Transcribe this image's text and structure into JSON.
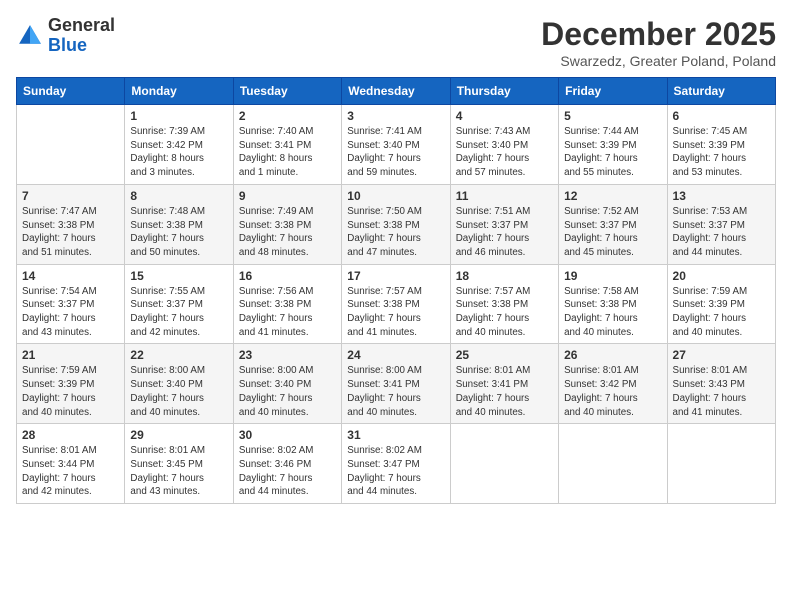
{
  "header": {
    "logo": {
      "text_general": "General",
      "text_blue": "Blue"
    },
    "title": "December 2025",
    "subtitle": "Swarzedz, Greater Poland, Poland"
  },
  "days_of_week": [
    "Sunday",
    "Monday",
    "Tuesday",
    "Wednesday",
    "Thursday",
    "Friday",
    "Saturday"
  ],
  "weeks": [
    [
      {
        "day": "",
        "info": ""
      },
      {
        "day": "1",
        "info": "Sunrise: 7:39 AM\nSunset: 3:42 PM\nDaylight: 8 hours\nand 3 minutes."
      },
      {
        "day": "2",
        "info": "Sunrise: 7:40 AM\nSunset: 3:41 PM\nDaylight: 8 hours\nand 1 minute."
      },
      {
        "day": "3",
        "info": "Sunrise: 7:41 AM\nSunset: 3:40 PM\nDaylight: 7 hours\nand 59 minutes."
      },
      {
        "day": "4",
        "info": "Sunrise: 7:43 AM\nSunset: 3:40 PM\nDaylight: 7 hours\nand 57 minutes."
      },
      {
        "day": "5",
        "info": "Sunrise: 7:44 AM\nSunset: 3:39 PM\nDaylight: 7 hours\nand 55 minutes."
      },
      {
        "day": "6",
        "info": "Sunrise: 7:45 AM\nSunset: 3:39 PM\nDaylight: 7 hours\nand 53 minutes."
      }
    ],
    [
      {
        "day": "7",
        "info": "Sunrise: 7:47 AM\nSunset: 3:38 PM\nDaylight: 7 hours\nand 51 minutes."
      },
      {
        "day": "8",
        "info": "Sunrise: 7:48 AM\nSunset: 3:38 PM\nDaylight: 7 hours\nand 50 minutes."
      },
      {
        "day": "9",
        "info": "Sunrise: 7:49 AM\nSunset: 3:38 PM\nDaylight: 7 hours\nand 48 minutes."
      },
      {
        "day": "10",
        "info": "Sunrise: 7:50 AM\nSunset: 3:38 PM\nDaylight: 7 hours\nand 47 minutes."
      },
      {
        "day": "11",
        "info": "Sunrise: 7:51 AM\nSunset: 3:37 PM\nDaylight: 7 hours\nand 46 minutes."
      },
      {
        "day": "12",
        "info": "Sunrise: 7:52 AM\nSunset: 3:37 PM\nDaylight: 7 hours\nand 45 minutes."
      },
      {
        "day": "13",
        "info": "Sunrise: 7:53 AM\nSunset: 3:37 PM\nDaylight: 7 hours\nand 44 minutes."
      }
    ],
    [
      {
        "day": "14",
        "info": "Sunrise: 7:54 AM\nSunset: 3:37 PM\nDaylight: 7 hours\nand 43 minutes."
      },
      {
        "day": "15",
        "info": "Sunrise: 7:55 AM\nSunset: 3:37 PM\nDaylight: 7 hours\nand 42 minutes."
      },
      {
        "day": "16",
        "info": "Sunrise: 7:56 AM\nSunset: 3:38 PM\nDaylight: 7 hours\nand 41 minutes."
      },
      {
        "day": "17",
        "info": "Sunrise: 7:57 AM\nSunset: 3:38 PM\nDaylight: 7 hours\nand 41 minutes."
      },
      {
        "day": "18",
        "info": "Sunrise: 7:57 AM\nSunset: 3:38 PM\nDaylight: 7 hours\nand 40 minutes."
      },
      {
        "day": "19",
        "info": "Sunrise: 7:58 AM\nSunset: 3:38 PM\nDaylight: 7 hours\nand 40 minutes."
      },
      {
        "day": "20",
        "info": "Sunrise: 7:59 AM\nSunset: 3:39 PM\nDaylight: 7 hours\nand 40 minutes."
      }
    ],
    [
      {
        "day": "21",
        "info": "Sunrise: 7:59 AM\nSunset: 3:39 PM\nDaylight: 7 hours\nand 40 minutes."
      },
      {
        "day": "22",
        "info": "Sunrise: 8:00 AM\nSunset: 3:40 PM\nDaylight: 7 hours\nand 40 minutes."
      },
      {
        "day": "23",
        "info": "Sunrise: 8:00 AM\nSunset: 3:40 PM\nDaylight: 7 hours\nand 40 minutes."
      },
      {
        "day": "24",
        "info": "Sunrise: 8:00 AM\nSunset: 3:41 PM\nDaylight: 7 hours\nand 40 minutes."
      },
      {
        "day": "25",
        "info": "Sunrise: 8:01 AM\nSunset: 3:41 PM\nDaylight: 7 hours\nand 40 minutes."
      },
      {
        "day": "26",
        "info": "Sunrise: 8:01 AM\nSunset: 3:42 PM\nDaylight: 7 hours\nand 40 minutes."
      },
      {
        "day": "27",
        "info": "Sunrise: 8:01 AM\nSunset: 3:43 PM\nDaylight: 7 hours\nand 41 minutes."
      }
    ],
    [
      {
        "day": "28",
        "info": "Sunrise: 8:01 AM\nSunset: 3:44 PM\nDaylight: 7 hours\nand 42 minutes."
      },
      {
        "day": "29",
        "info": "Sunrise: 8:01 AM\nSunset: 3:45 PM\nDaylight: 7 hours\nand 43 minutes."
      },
      {
        "day": "30",
        "info": "Sunrise: 8:02 AM\nSunset: 3:46 PM\nDaylight: 7 hours\nand 44 minutes."
      },
      {
        "day": "31",
        "info": "Sunrise: 8:02 AM\nSunset: 3:47 PM\nDaylight: 7 hours\nand 44 minutes."
      },
      {
        "day": "",
        "info": ""
      },
      {
        "day": "",
        "info": ""
      },
      {
        "day": "",
        "info": ""
      }
    ]
  ]
}
